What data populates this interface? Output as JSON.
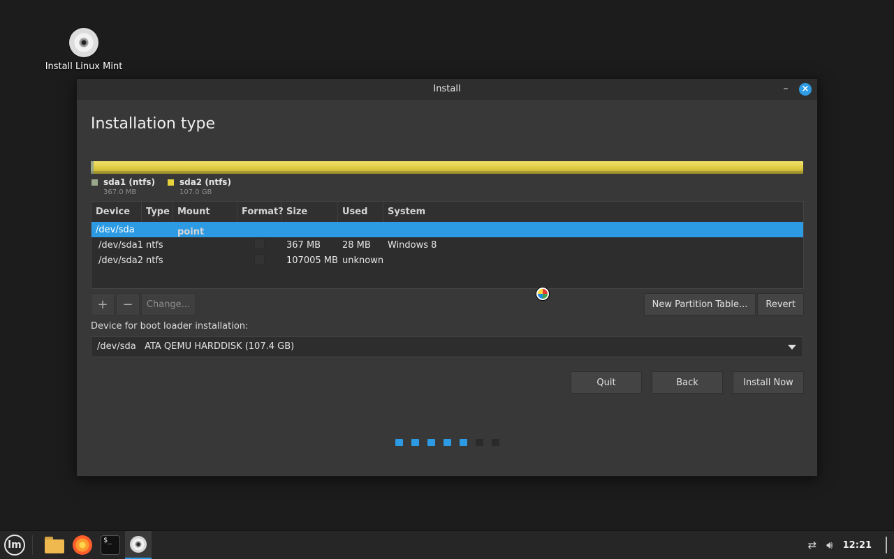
{
  "desktop": {
    "icon_label": "Install Linux Mint"
  },
  "window": {
    "title": "Install",
    "minimize": "–",
    "close": "×"
  },
  "page": {
    "heading": "Installation type"
  },
  "legend": [
    {
      "name": "sda1 (ntfs)",
      "size": "367.0 MB",
      "color": "#9aa98a"
    },
    {
      "name": "sda2 (ntfs)",
      "size": "107.0 GB",
      "color": "#e6d33c"
    }
  ],
  "table": {
    "headers": [
      "Device",
      "Type",
      "Mount point",
      "Format?",
      "Size",
      "Used",
      "System"
    ],
    "rows": [
      {
        "device": "/dev/sda",
        "type": "",
        "mount": "",
        "size": "",
        "used": "",
        "system": ""
      },
      {
        "device": "/dev/sda1",
        "type": "ntfs",
        "mount": "",
        "size": "367 MB",
        "used": "28 MB",
        "system": "Windows 8"
      },
      {
        "device": "/dev/sda2",
        "type": "ntfs",
        "mount": "",
        "size": "107005 MB",
        "used": "unknown",
        "system": ""
      }
    ]
  },
  "toolbar": {
    "add": "+",
    "remove": "−",
    "change": "Change...",
    "new_table": "New Partition Table...",
    "revert": "Revert"
  },
  "boot": {
    "label": "Device for boot loader installation:",
    "value": "/dev/sda   ATA QEMU HARDDISK (107.4 GB)"
  },
  "actions": {
    "quit": "Quit",
    "back": "Back",
    "install": "Install Now"
  },
  "progress": {
    "total_steps": 7,
    "completed_steps": 5,
    "accent": "#2c9be4"
  },
  "taskbar": {
    "menu_logo": "lm",
    "terminal_prompt": "$_",
    "clock": "12:21"
  }
}
